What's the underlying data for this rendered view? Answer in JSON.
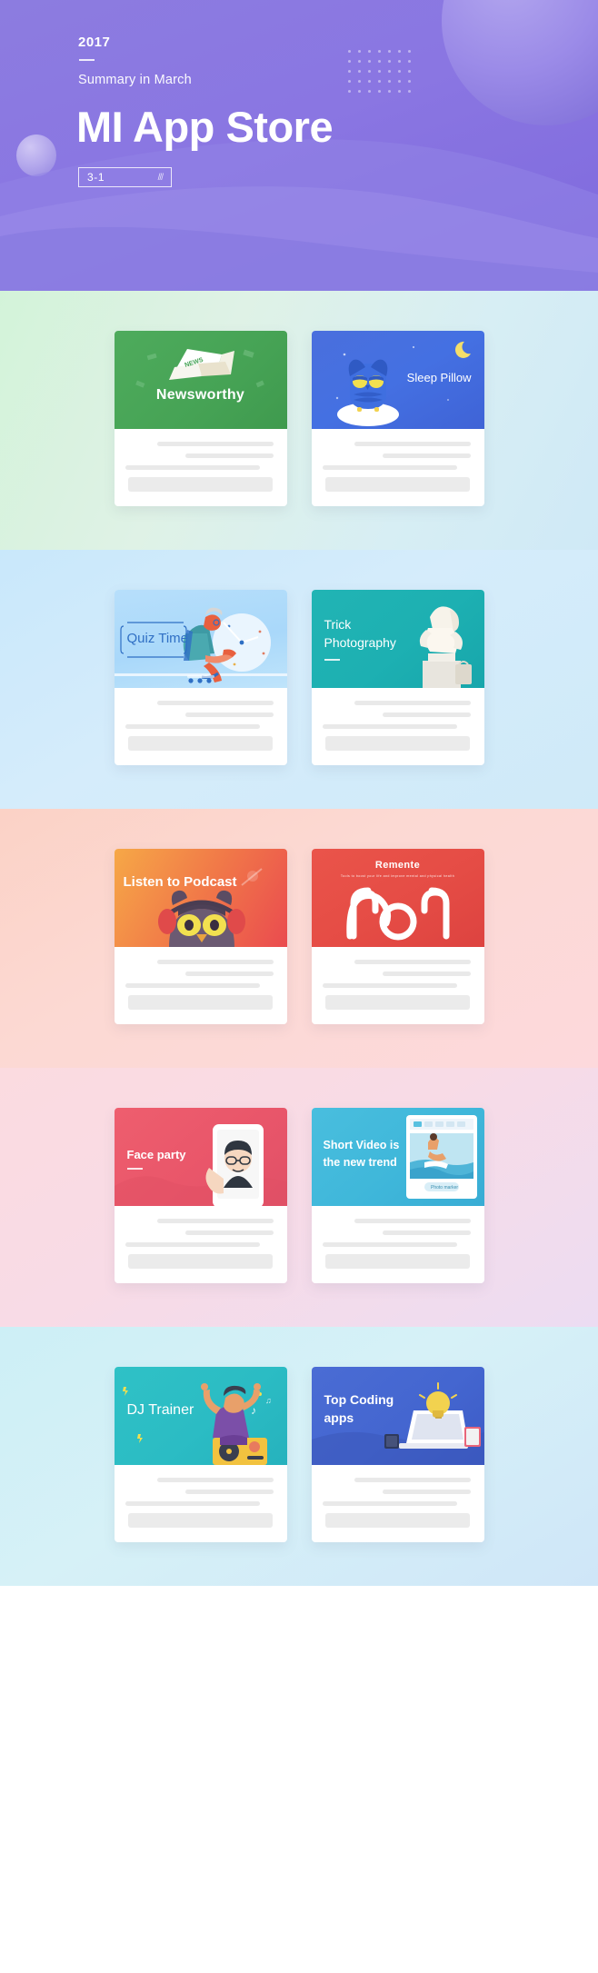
{
  "header": {
    "year": "2017",
    "subtitle": "Summary in March",
    "title": "MI App Store",
    "badge_number": "3-1",
    "badge_slashes": "///",
    "bg_color": "#8a76e2",
    "icons": [
      "planet-icon",
      "moon-icon",
      "dot-grid-icon",
      "wave-icon"
    ]
  },
  "sections": [
    {
      "name": "row-1",
      "bg_color": "#d7eee3",
      "cards": [
        {
          "title": "Newsworthy",
          "thumb_color": "#46a355",
          "art": "newspaper-icon"
        },
        {
          "title": "Sleep Pillow",
          "thumb_color": "#4470e2",
          "art": "owl-icon"
        }
      ]
    },
    {
      "name": "row-2",
      "bg_color": "#d0eafa",
      "cards": [
        {
          "title": "Quiz Time",
          "thumb_color": "#a9d8fa",
          "art": "person-laptop-clock-icon"
        },
        {
          "title": "Trick Photography",
          "thumb_color": "#1db0b2",
          "art": "woman-statue-icon"
        }
      ]
    },
    {
      "name": "row-3",
      "bg_color": "#fcd7d1",
      "cards": [
        {
          "title": "Listen to Podcast",
          "thumb_color": "#f17a48",
          "art": "owl-headphones-icon"
        },
        {
          "title": "Remente",
          "subtitle": "Tools to boost your life and improve mental and physical health",
          "thumb_color": "#e54c45",
          "art": "remente-logo-icon"
        }
      ]
    },
    {
      "name": "row-4",
      "bg_color": "#f6dce6",
      "cards": [
        {
          "title": "Face party",
          "thumb_color": "#e9566a",
          "art": "phone-face-icon"
        },
        {
          "title": "Short Video is the new trend",
          "thumb_color": "#3fb7da",
          "art": "phone-video-icon"
        }
      ]
    },
    {
      "name": "row-5",
      "bg_color": "#d4eff7",
      "cards": [
        {
          "title": "DJ Trainer",
          "thumb_color": "#2bbcc4",
          "art": "dj-person-icon"
        },
        {
          "title": "Top Coding apps",
          "thumb_color": "#4466d0",
          "art": "laptop-bulb-icon"
        }
      ]
    }
  ]
}
